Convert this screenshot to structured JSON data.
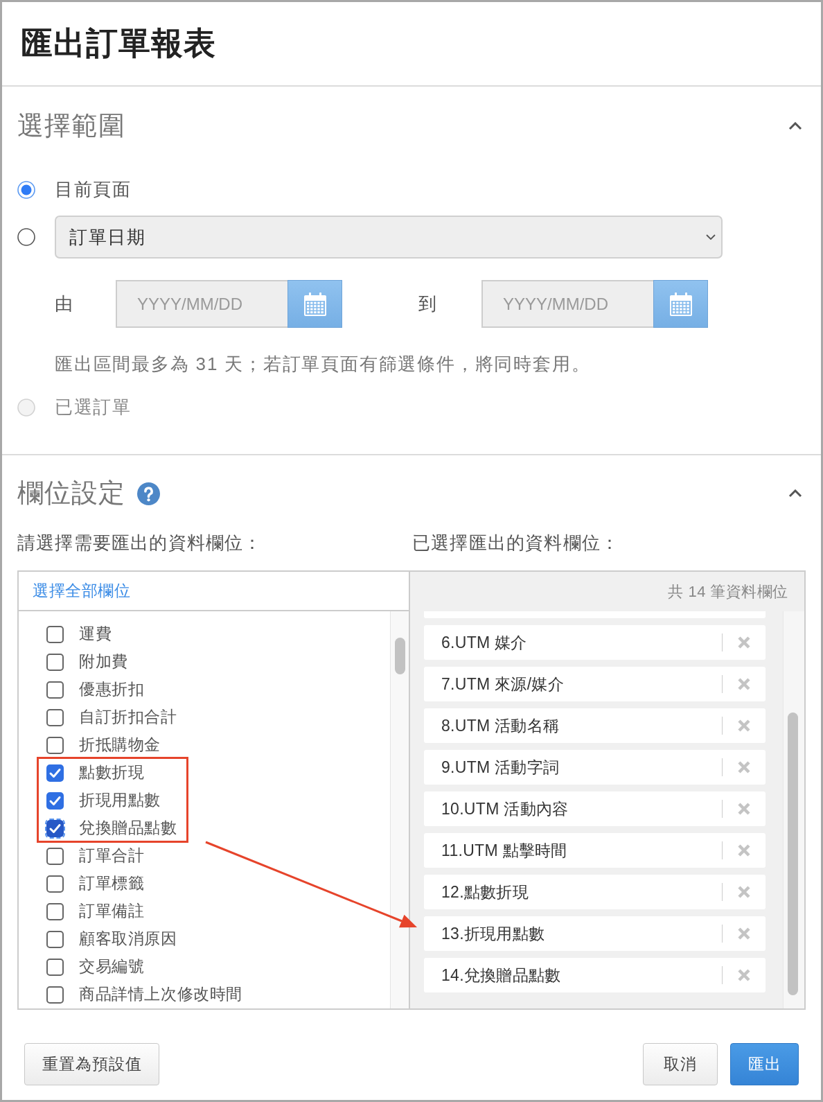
{
  "dialog": {
    "title": "匯出訂單報表"
  },
  "range_section": {
    "title": "選擇範圍",
    "expanded": true,
    "options": [
      {
        "kind": "plain",
        "label": "目前頁面",
        "selected": true,
        "disabled": false
      },
      {
        "kind": "dropdown",
        "value": "訂單日期",
        "selected": false,
        "disabled": false,
        "date_from": {
          "label": "由",
          "placeholder": "YYYY/MM/DD"
        },
        "date_to": {
          "label": "到",
          "placeholder": "YYYY/MM/DD"
        },
        "note": "匯出區間最多為 31 天；若訂單頁面有篩選條件，將同時套用。"
      },
      {
        "kind": "plain",
        "label": "已選訂單",
        "selected": false,
        "disabled": true
      }
    ]
  },
  "fields_section": {
    "title": "欄位設定",
    "expanded": true,
    "available_label": "請選擇需要匯出的資料欄位：",
    "selected_label": "已選擇匯出的資料欄位：",
    "select_all": "選擇全部欄位",
    "available": [
      {
        "label": "運費",
        "checked": false,
        "focused": false
      },
      {
        "label": "附加費",
        "checked": false,
        "focused": false
      },
      {
        "label": "優惠折扣",
        "checked": false,
        "focused": false
      },
      {
        "label": "自訂折扣合計",
        "checked": false,
        "focused": false
      },
      {
        "label": "折抵購物金",
        "checked": false,
        "focused": false
      },
      {
        "label": "點數折現",
        "checked": true,
        "focused": false
      },
      {
        "label": "折現用點數",
        "checked": true,
        "focused": false
      },
      {
        "label": "兌換贈品點數",
        "checked": true,
        "focused": true
      },
      {
        "label": "訂單合計",
        "checked": false,
        "focused": false
      },
      {
        "label": "訂單標籤",
        "checked": false,
        "focused": false
      },
      {
        "label": "訂單備註",
        "checked": false,
        "focused": false
      },
      {
        "label": "顧客取消原因",
        "checked": false,
        "focused": false
      },
      {
        "label": "交易編號",
        "checked": false,
        "focused": false
      },
      {
        "label": "商品詳情上次修改時間",
        "checked": false,
        "focused": false
      }
    ],
    "selected_count": "共 14 筆資料欄位",
    "selected_fields": [
      "6.UTM 媒介",
      "7.UTM 來源/媒介",
      "8.UTM 活動名稱",
      "9.UTM 活動字詞",
      "10.UTM 活動內容",
      "11.UTM 點擊時間",
      "12.點數折現",
      "13.折現用點數",
      "14.兌換贈品點數"
    ]
  },
  "footer": {
    "reset_button": "重置為預設值",
    "actions": [
      {
        "label": "取消",
        "kind": "default"
      },
      {
        "label": "匯出",
        "kind": "primary"
      }
    ]
  }
}
